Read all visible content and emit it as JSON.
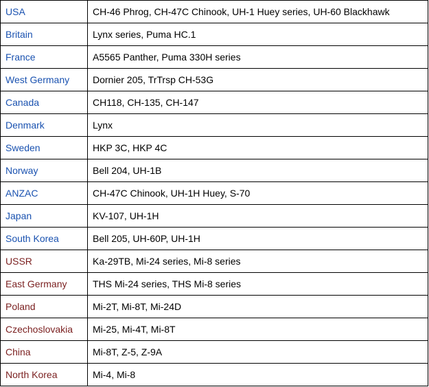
{
  "colors": {
    "nato_link": "#1a52b0",
    "warsaw_link": "#7a1f1f",
    "border": "#000000"
  },
  "rows": [
    {
      "country": "USA",
      "group": "blue",
      "helicopters": "CH-46 Phrog, CH-47C Chinook, UH-1 Huey series, UH-60 Blackhawk"
    },
    {
      "country": "Britain",
      "group": "blue",
      "helicopters": "Lynx series, Puma HC.1"
    },
    {
      "country": "France",
      "group": "blue",
      "helicopters": "A5565 Panther, Puma 330H series"
    },
    {
      "country": "West Germany",
      "group": "blue",
      "helicopters": "Dornier 205, TrTrsp CH-53G"
    },
    {
      "country": "Canada",
      "group": "blue",
      "helicopters": "CH118, CH-135, CH-147"
    },
    {
      "country": "Denmark",
      "group": "blue",
      "helicopters": "Lynx"
    },
    {
      "country": "Sweden",
      "group": "blue",
      "helicopters": "HKP 3C, HKP 4C"
    },
    {
      "country": "Norway",
      "group": "blue",
      "helicopters": "Bell 204, UH-1B"
    },
    {
      "country": "ANZAC",
      "group": "blue",
      "helicopters": "CH-47C Chinook, UH-1H Huey, S-70"
    },
    {
      "country": "Japan",
      "group": "blue",
      "helicopters": "KV-107, UH-1H"
    },
    {
      "country": "South Korea",
      "group": "blue",
      "helicopters": "Bell 205, UH-60P, UH-1H"
    },
    {
      "country": "USSR",
      "group": "red",
      "helicopters": "Ka-29TB, Mi-24 series, Mi-8 series"
    },
    {
      "country": "East Germany",
      "group": "red",
      "helicopters": "THS Mi-24 series, THS Mi-8 series"
    },
    {
      "country": "Poland",
      "group": "red",
      "helicopters": "Mi-2T, Mi-8T, Mi-24D"
    },
    {
      "country": "Czechoslovakia",
      "group": "red",
      "helicopters": "Mi-25, Mi-4T, Mi-8T"
    },
    {
      "country": "China",
      "group": "red",
      "helicopters": "Mi-8T, Z-5, Z-9A"
    },
    {
      "country": "North Korea",
      "group": "red",
      "helicopters": "Mi-4, Mi-8"
    }
  ]
}
